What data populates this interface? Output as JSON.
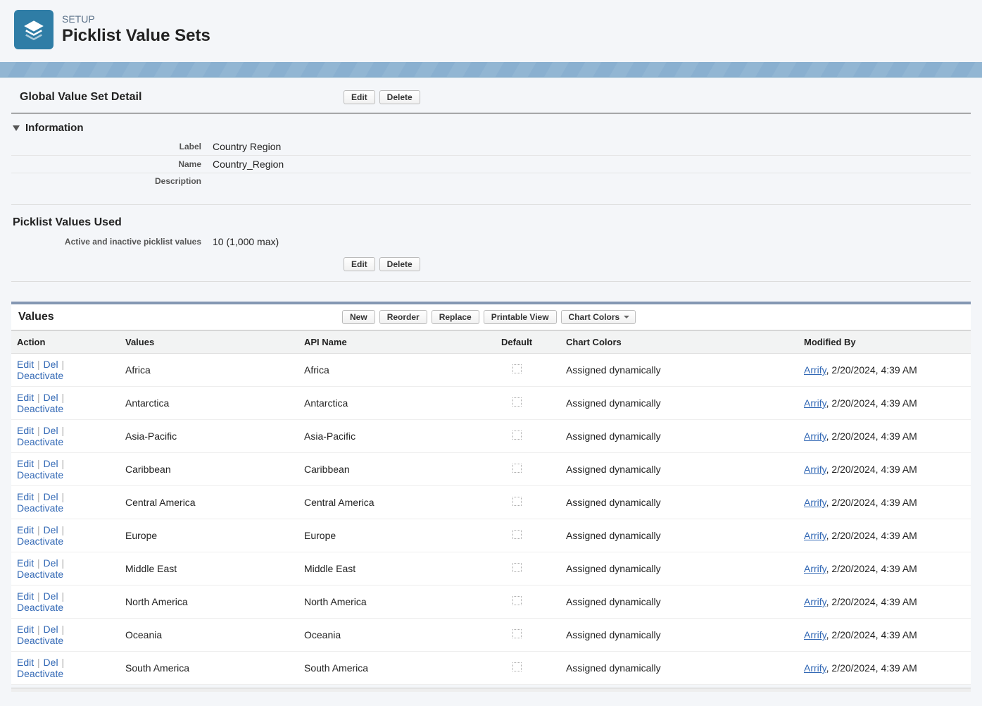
{
  "header": {
    "kicker": "SETUP",
    "title": "Picklist Value Sets"
  },
  "detail": {
    "title": "Global Value Set Detail",
    "edit": "Edit",
    "delete": "Delete",
    "information_header": "Information",
    "label_label": "Label",
    "label_value": "Country Region",
    "name_label": "Name",
    "name_value": "Country_Region",
    "desc_label": "Description",
    "desc_value": ""
  },
  "picklist_used": {
    "title": "Picklist Values Used",
    "count_label": "Active and inactive picklist values",
    "count_value": "10 (1,000 max)"
  },
  "values_section": {
    "title": "Values",
    "new": "New",
    "reorder": "Reorder",
    "replace": "Replace",
    "printable": "Printable View",
    "chart_colors": "Chart Colors"
  },
  "columns": {
    "action": "Action",
    "values": "Values",
    "api": "API Name",
    "default": "Default",
    "colors": "Chart Colors",
    "modified": "Modified By"
  },
  "action_labels": {
    "edit": "Edit",
    "del": "Del",
    "deactivate": "Deactivate"
  },
  "modified_user": "Arrify",
  "modified_stamp": ", 2/20/2024, 4:39 AM",
  "rows": [
    {
      "value": "Africa",
      "api": "Africa",
      "colors": "Assigned dynamically"
    },
    {
      "value": "Antarctica",
      "api": "Antarctica",
      "colors": "Assigned dynamically"
    },
    {
      "value": "Asia-Pacific",
      "api": "Asia-Pacific",
      "colors": "Assigned dynamically"
    },
    {
      "value": "Caribbean",
      "api": "Caribbean",
      "colors": "Assigned dynamically"
    },
    {
      "value": "Central America",
      "api": "Central America",
      "colors": "Assigned dynamically"
    },
    {
      "value": "Europe",
      "api": "Europe",
      "colors": "Assigned dynamically"
    },
    {
      "value": "Middle East",
      "api": "Middle East",
      "colors": "Assigned dynamically"
    },
    {
      "value": "North America",
      "api": "North America",
      "colors": "Assigned dynamically"
    },
    {
      "value": "Oceania",
      "api": "Oceania",
      "colors": "Assigned dynamically"
    },
    {
      "value": "South America",
      "api": "South America",
      "colors": "Assigned dynamically"
    }
  ]
}
